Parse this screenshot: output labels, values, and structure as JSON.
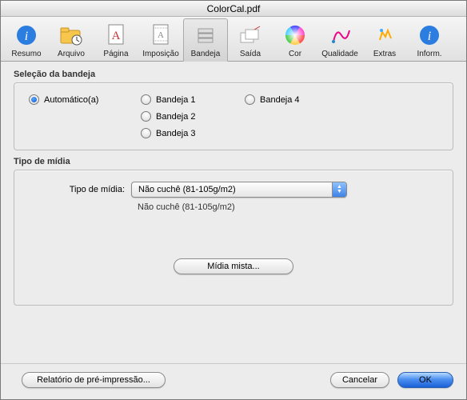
{
  "window": {
    "title": "ColorCal.pdf"
  },
  "toolbar": {
    "items": [
      {
        "label": "Resumo",
        "icon": "info"
      },
      {
        "label": "Arquivo",
        "icon": "folder-clock"
      },
      {
        "label": "Página",
        "icon": "page"
      },
      {
        "label": "Imposição",
        "icon": "impose"
      },
      {
        "label": "Bandeja",
        "icon": "tray"
      },
      {
        "label": "Saída",
        "icon": "output"
      },
      {
        "label": "Cor",
        "icon": "color-wheel"
      },
      {
        "label": "Qualidade",
        "icon": "quality"
      },
      {
        "label": "Extras",
        "icon": "extras"
      },
      {
        "label": "Inform.",
        "icon": "info-blue"
      }
    ],
    "active_index": 4
  },
  "tray_section": {
    "title": "Seleção da bandeja",
    "options": {
      "auto": "Automático(a)",
      "tray1": "Bandeja 1",
      "tray2": "Bandeja 2",
      "tray3": "Bandeja 3",
      "tray4": "Bandeja 4"
    },
    "selected": "auto"
  },
  "media_section": {
    "title": "Tipo de mídia",
    "label": "Tipo de mídia:",
    "selected_value": "Não cuchê (81-105g/m2)",
    "subtext": "Não cuchê (81-105g/m2)",
    "mixed_button": "Mídia mista..."
  },
  "footer": {
    "report": "Relatório de pré-impressão...",
    "cancel": "Cancelar",
    "ok": "OK"
  }
}
